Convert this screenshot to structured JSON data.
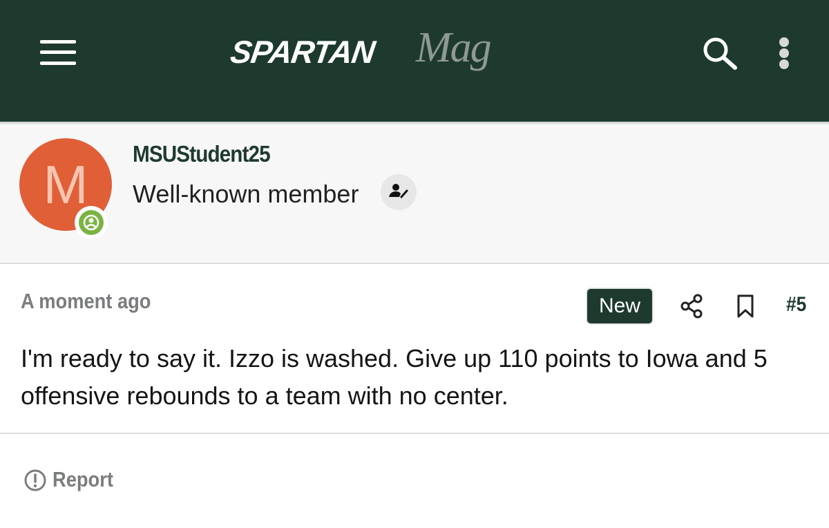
{
  "header": {
    "logo_main": "SPARTAN",
    "logo_script": "Mag",
    "menu_icon": "hamburger-menu-icon",
    "search_icon": "search-icon",
    "more_icon": "more-vertical-icon",
    "background": "#1e3a2e"
  },
  "user": {
    "avatar_letter": "M",
    "avatar_color": "#e05f37",
    "online_icon": "user-online-icon",
    "online_color": "#7bb342",
    "username": "MSUStudent25",
    "title": "Well-known member",
    "title_icon": "user-edit-icon"
  },
  "post": {
    "time": "A moment ago",
    "new_badge": "New",
    "share_icon": "share-icon",
    "bookmark_icon": "bookmark-icon",
    "number": "#5",
    "body": "I'm ready to say it. Izzo is washed. Give up 110 points to Iowa and 5 offensive rebounds to a team with no center."
  },
  "footer": {
    "report_label": "Report",
    "report_icon": "alert-circle-icon"
  }
}
